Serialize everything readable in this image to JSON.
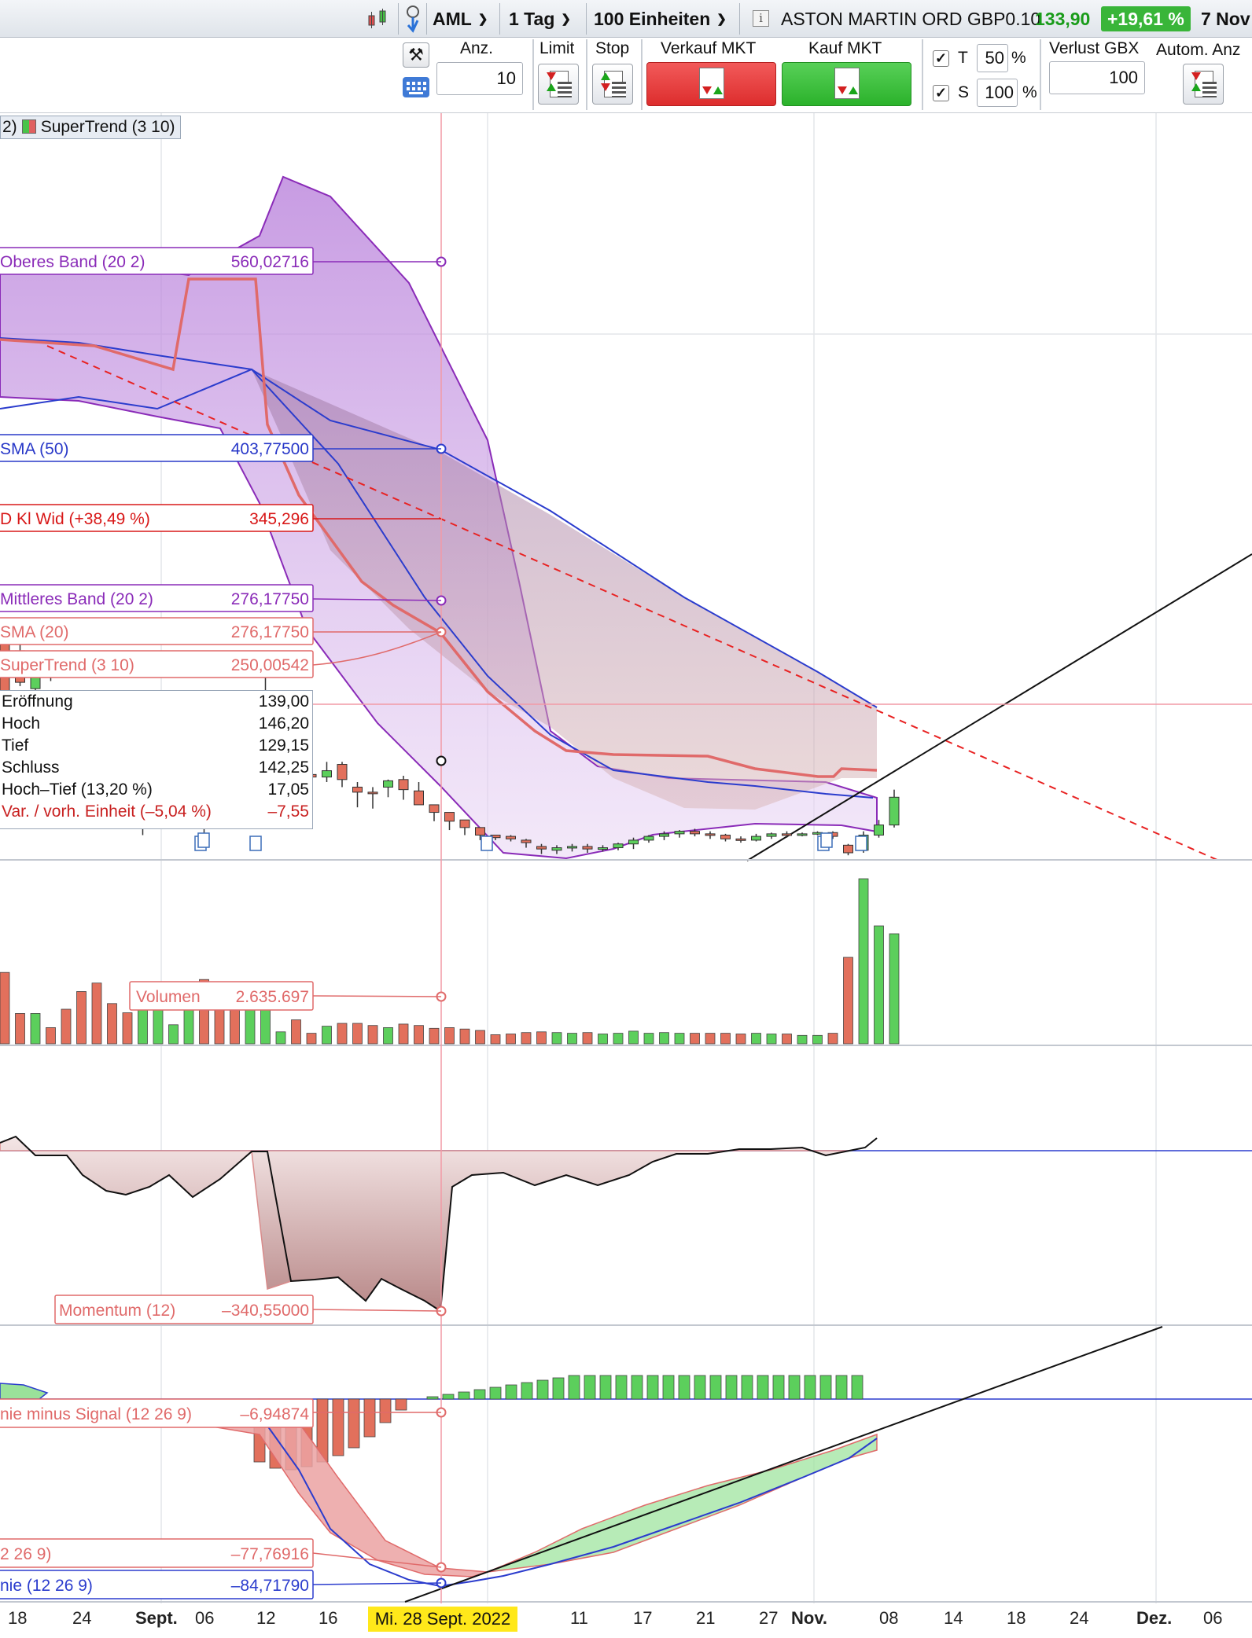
{
  "toolbar": {
    "symbol": "AML",
    "interval": "1 Tag",
    "units": "100 Einheiten",
    "instrument": "ASTON MARTIN ORD GBP0.10",
    "price": "133,90",
    "change": "+19,61 %",
    "date": "7 Nov"
  },
  "order": {
    "qty_label": "Anz.",
    "qty_value": "10",
    "limit_label": "Limit",
    "stop_label": "Stop",
    "sell_label": "Verkauf MKT",
    "buy_label": "Kauf MKT",
    "t_label": "T",
    "t_value": "50",
    "s_label": "S",
    "s_value": "100",
    "pct": "%",
    "loss_label": "Verlust GBX",
    "loss_value": "100",
    "auto_label": "Autom. Anz"
  },
  "legend": {
    "prefix": "2)",
    "supertrend": "SuperTrend (3 10)"
  },
  "indicator_labels": [
    {
      "name": "Oberes Band (20 2)",
      "value": "560,02716",
      "color": "#8a2bb8"
    },
    {
      "name": "SMA (50)",
      "value": "403,77500",
      "color": "#2838c8"
    },
    {
      "name": "D Kl Wid (+38,49 %)",
      "value": "345,296",
      "color": "#d81818"
    },
    {
      "name": "Mittleres Band (20 2)",
      "value": "276,17750",
      "color": "#8a2bb8"
    },
    {
      "name": "SMA (20)",
      "value": "276,17750",
      "color": "#e06a6a"
    },
    {
      "name": "SuperTrend (3 10)",
      "value": "250,00542",
      "color": "#e06a6a"
    }
  ],
  "ohlc": [
    {
      "k": "Eröffnung",
      "v": "139,00"
    },
    {
      "k": "Hoch",
      "v": "146,20"
    },
    {
      "k": "Tief",
      "v": "129,15"
    },
    {
      "k": "Schluss",
      "v": "142,25"
    },
    {
      "k": "Hoch–Tief (13,20 %)",
      "v": "17,05"
    },
    {
      "k": "Var. / vorh. Einheit (–5,04 %)",
      "v": "–7,55",
      "red": true
    }
  ],
  "panes": {
    "volume": {
      "name": "Volumen",
      "value": "2.635.697"
    },
    "momentum": {
      "name": "Momentum (12)",
      "value": "–340,55000"
    },
    "macd_hist": {
      "name": "nie minus Signal (12 26 9)",
      "value": "–6,94874"
    },
    "macd_signal": {
      "name": "2 26 9)",
      "value": "–77,76916"
    },
    "macd_line": {
      "name": "nie (12 26 9)",
      "value": "–84,71790"
    }
  },
  "xaxis": {
    "labels": [
      "18",
      "24",
      "Sept.",
      "06",
      "12",
      "16",
      "11",
      "17",
      "21",
      "27",
      "Nov.",
      "08",
      "14",
      "18",
      "24",
      "Dez.",
      "06"
    ],
    "crosshair_date": "Mi. 28 Sept. 2022"
  },
  "chart_data": {
    "type": "candlestick",
    "symbol": "AML",
    "interval": "1 Tag",
    "candles": [
      {
        "o": 262,
        "c": 183,
        "h": 268,
        "l": 176
      },
      {
        "o": 250,
        "c": 225,
        "h": 256,
        "l": 222
      },
      {
        "o": 220,
        "c": 245,
        "h": 250,
        "l": 216
      },
      {
        "o": 238,
        "c": 230,
        "h": 240,
        "l": 226
      },
      {
        "o": 215,
        "c": 185,
        "h": 218,
        "l": 178
      },
      {
        "o": 208,
        "c": 200,
        "h": 215,
        "l": 150
      },
      {
        "o": 212,
        "c": 155,
        "h": 215,
        "l": 138
      },
      {
        "o": 165,
        "c": 138,
        "h": 170,
        "l": 122
      },
      {
        "o": 140,
        "c": 118,
        "h": 145,
        "l": 110
      },
      {
        "o": 125,
        "c": 142,
        "h": 150,
        "l": 104
      },
      {
        "o": 135,
        "c": 148,
        "h": 155,
        "l": 112
      },
      {
        "o": 148,
        "c": 150,
        "h": 160,
        "l": 142
      },
      {
        "o": 150,
        "c": 210,
        "h": 215,
        "l": 146
      },
      {
        "o": 180,
        "c": 110,
        "h": 182,
        "l": 100
      },
      {
        "o": 130,
        "c": 125,
        "h": 175,
        "l": 110
      },
      {
        "o": 132,
        "c": 120,
        "h": 160,
        "l": 110
      },
      {
        "o": 155,
        "c": 190,
        "h": 195,
        "l": 140
      },
      {
        "o": 200,
        "c": 215,
        "h": 238,
        "l": 195
      },
      {
        "o": 145,
        "c": 150,
        "h": 148,
        "l": 140
      },
      {
        "o": 150,
        "c": 148,
        "h": 165,
        "l": 140
      },
      {
        "o": 152,
        "c": 150,
        "h": 152,
        "l": 146
      },
      {
        "o": 150,
        "c": 155,
        "h": 162,
        "l": 146
      },
      {
        "o": 160,
        "c": 148,
        "h": 162,
        "l": 142
      },
      {
        "o": 142,
        "c": 138,
        "h": 146,
        "l": 126
      },
      {
        "o": 138,
        "c": 137,
        "h": 142,
        "l": 125
      },
      {
        "o": 142,
        "c": 147,
        "h": 148,
        "l": 134
      },
      {
        "o": 148,
        "c": 140,
        "h": 151,
        "l": 132
      },
      {
        "o": 139,
        "c": 128,
        "h": 146,
        "l": 129
      },
      {
        "o": 128,
        "c": 122,
        "h": 128,
        "l": 115
      },
      {
        "o": 122,
        "c": 115,
        "h": 122,
        "l": 108
      },
      {
        "o": 116,
        "c": 110,
        "h": 116,
        "l": 104
      },
      {
        "o": 110,
        "c": 104,
        "h": 110,
        "l": 100
      },
      {
        "o": 104,
        "c": 102,
        "h": 104,
        "l": 100
      },
      {
        "o": 103,
        "c": 101,
        "h": 104,
        "l": 99
      },
      {
        "o": 100,
        "c": 98,
        "h": 101,
        "l": 94
      },
      {
        "o": 95,
        "c": 93,
        "h": 97,
        "l": 89
      },
      {
        "o": 92,
        "c": 94,
        "h": 96,
        "l": 89
      },
      {
        "o": 94,
        "c": 95,
        "h": 97,
        "l": 91
      },
      {
        "o": 95,
        "c": 93,
        "h": 97,
        "l": 90
      },
      {
        "o": 93,
        "c": 94,
        "h": 96,
        "l": 91
      },
      {
        "o": 94,
        "c": 97,
        "h": 98,
        "l": 92
      },
      {
        "o": 97,
        "c": 100,
        "h": 102,
        "l": 93
      },
      {
        "o": 100,
        "c": 103,
        "h": 104,
        "l": 98
      },
      {
        "o": 103,
        "c": 105,
        "h": 107,
        "l": 100
      },
      {
        "o": 105,
        "c": 107,
        "h": 108,
        "l": 102
      },
      {
        "o": 107,
        "c": 105,
        "h": 109,
        "l": 103
      },
      {
        "o": 105,
        "c": 104,
        "h": 107,
        "l": 101
      },
      {
        "o": 104,
        "c": 101,
        "h": 105,
        "l": 99
      },
      {
        "o": 101,
        "c": 100,
        "h": 103,
        "l": 98
      },
      {
        "o": 100,
        "c": 103,
        "h": 105,
        "l": 99
      },
      {
        "o": 103,
        "c": 105,
        "h": 106,
        "l": 101
      },
      {
        "o": 105,
        "c": 104,
        "h": 107,
        "l": 102
      },
      {
        "o": 104,
        "c": 105,
        "h": 106,
        "l": 103
      },
      {
        "o": 105,
        "c": 106,
        "h": 107,
        "l": 104
      },
      {
        "o": 106,
        "c": 103,
        "h": 107,
        "l": 101
      },
      {
        "o": 96,
        "c": 90,
        "h": 97,
        "l": 88
      },
      {
        "o": 92,
        "c": 104,
        "h": 107,
        "l": 90
      },
      {
        "o": 104,
        "c": 112,
        "h": 116,
        "l": 102
      },
      {
        "o": 112,
        "c": 134,
        "h": 140,
        "l": 110
      }
    ]
  }
}
